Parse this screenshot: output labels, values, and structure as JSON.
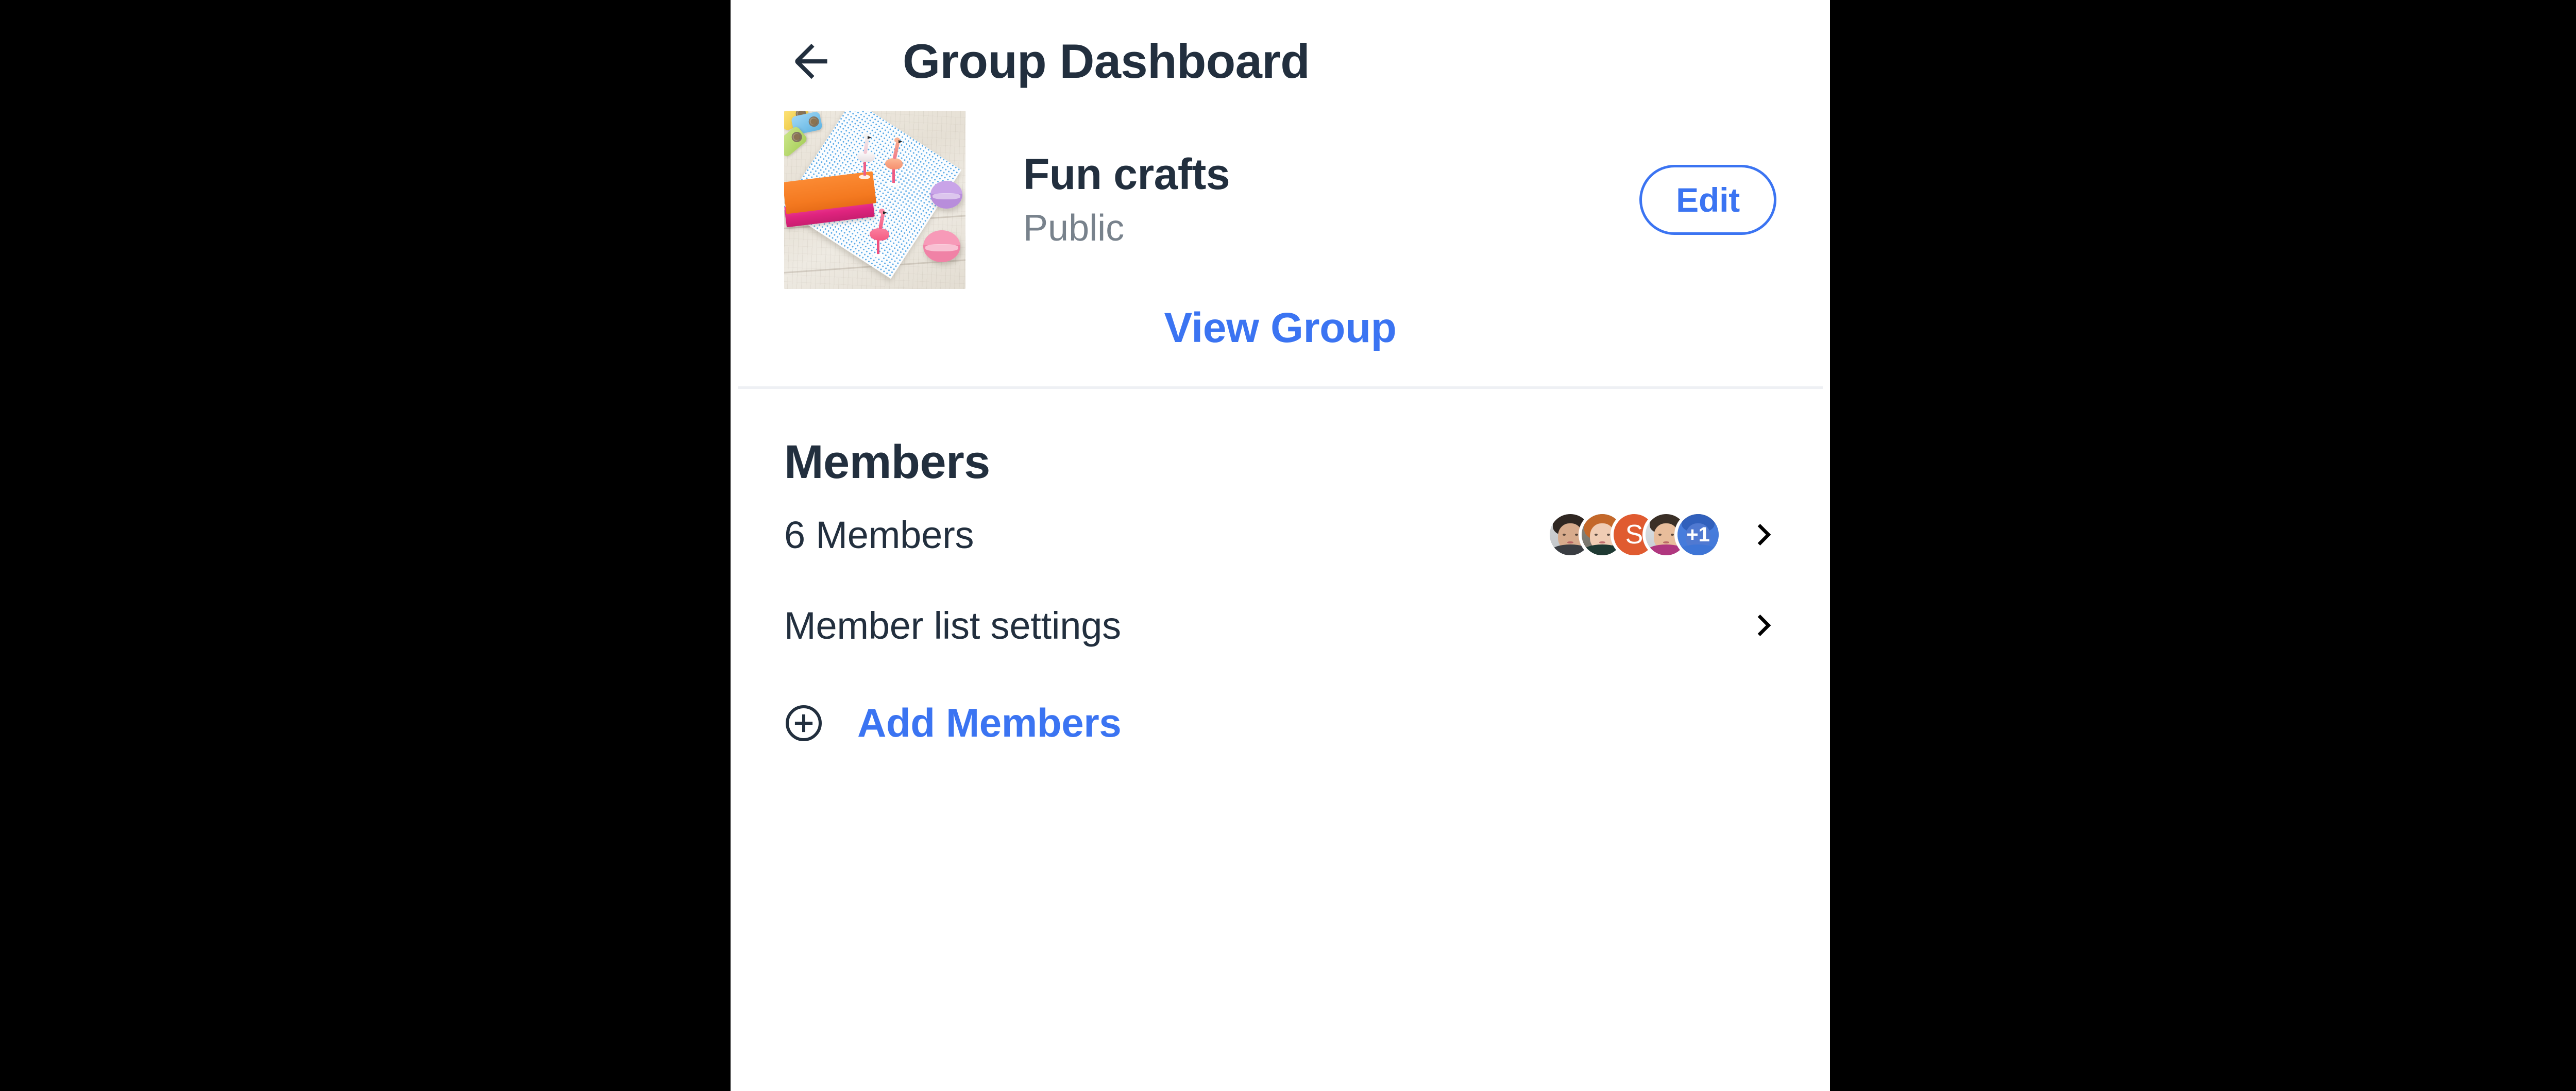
{
  "header": {
    "back_icon": "arrow-left-icon",
    "title": "Group Dashboard"
  },
  "group": {
    "thumbnail_alt": "craft supplies photo",
    "name": "Fun crafts",
    "privacy": "Public",
    "edit_label": "Edit",
    "view_group_label": "View Group"
  },
  "members": {
    "section_title": "Members",
    "count_row": {
      "label": "6 Members",
      "chevron_icon": "chevron-right-icon",
      "avatars": [
        {
          "type": "photo",
          "name": "member-avatar-1"
        },
        {
          "type": "photo",
          "name": "member-avatar-2"
        },
        {
          "type": "initial",
          "name": "member-avatar-3",
          "initial": "S",
          "color": "#E05B30"
        },
        {
          "type": "photo",
          "name": "member-avatar-4"
        },
        {
          "type": "overflow",
          "name": "member-avatar-overflow",
          "label": "+1",
          "color": "#2A6AE0"
        }
      ]
    },
    "settings_row": {
      "label": "Member list settings",
      "chevron_icon": "chevron-right-icon"
    },
    "add_row": {
      "icon": "plus-circle-icon",
      "label": "Add Members"
    }
  },
  "colors": {
    "accent_blue": "#3B74F2",
    "text_dark": "#222F3E",
    "text_muted": "#78828C",
    "divider": "#EEF0F4",
    "avatar_orange": "#E05B30",
    "avatar_overflow_blue": "#2A6AE0",
    "letterbox": "#000000",
    "panel_bg": "#FFFFFF"
  }
}
